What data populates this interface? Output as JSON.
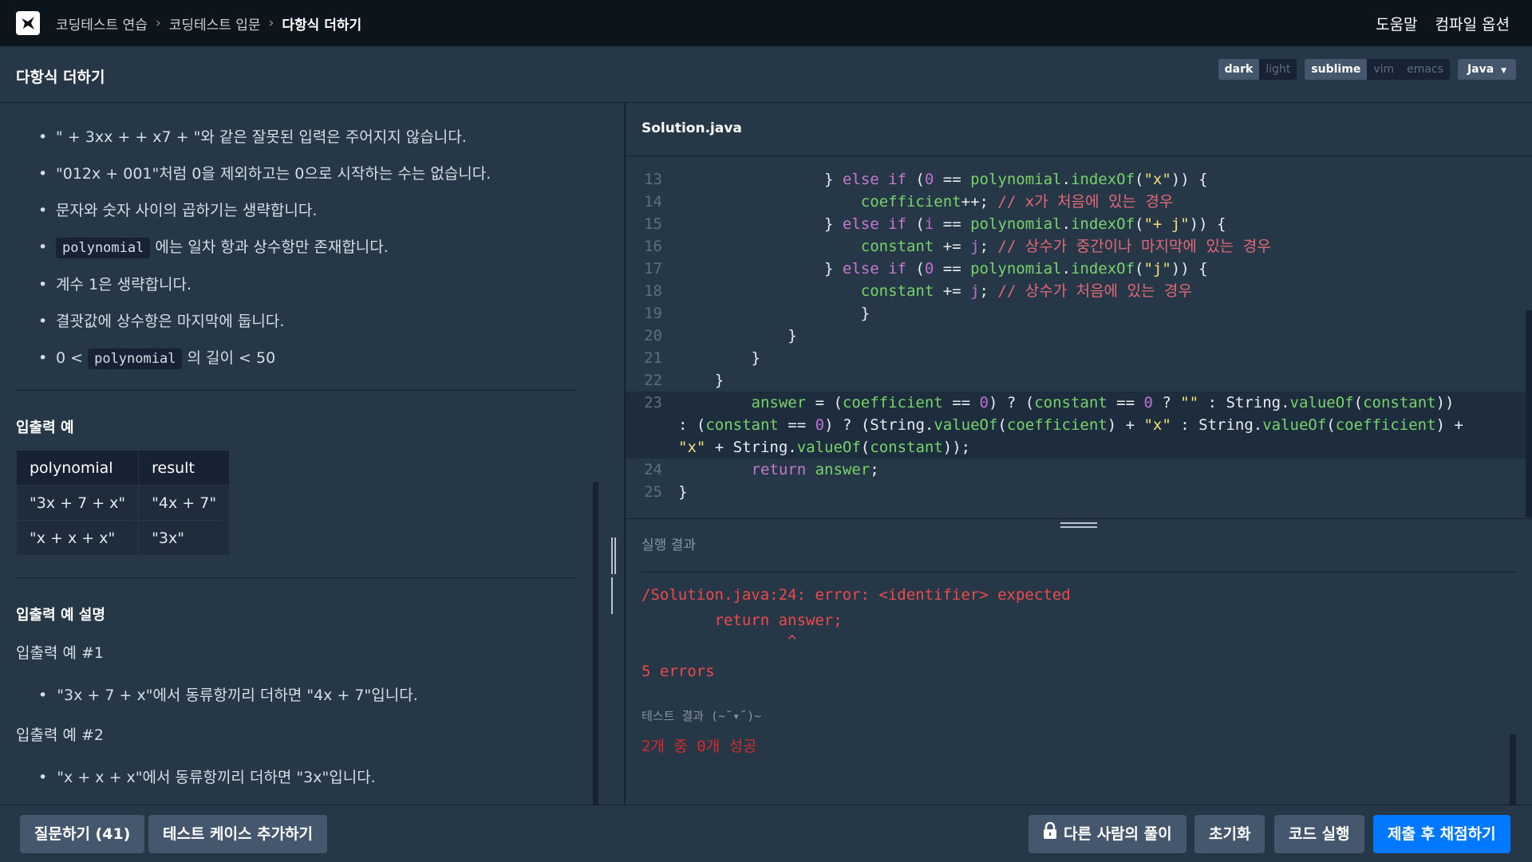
{
  "topbar": {
    "breadcrumbs": [
      "코딩테스트 연습",
      "코딩테스트 입문",
      "다항식 더하기"
    ],
    "menu_help": "도움말",
    "menu_compile": "컴파일 옵션"
  },
  "titlebar": {
    "title": "다항식 더하기",
    "theme_options": [
      "dark",
      "light"
    ],
    "keymap_options": [
      "sublime",
      "vim",
      "emacs"
    ],
    "language": "Java"
  },
  "problem": {
    "rules": [
      {
        "pre": "\" + 3xx + + x7 + \"와 같은 잘못된 입력은 주어지지 않습니다.",
        "code": "",
        "post": ""
      },
      {
        "pre": "\"012x + 001\"처럼 0을 제외하고는 0으로 시작하는 수는 없습니다.",
        "code": "",
        "post": ""
      },
      {
        "pre": "문자와 숫자 사이의 곱하기는 생략합니다.",
        "code": "",
        "post": ""
      },
      {
        "pre": "",
        "code": "polynomial",
        "post": "에는 일차 항과 상수항만 존재합니다."
      },
      {
        "pre": "계수 1은 생략합니다.",
        "code": "",
        "post": ""
      },
      {
        "pre": "결괏값에 상수항은 마지막에 둡니다.",
        "code": "",
        "post": ""
      },
      {
        "pre": "0 < ",
        "code": "polynomial",
        "post": "의 길이 < 50"
      }
    ],
    "io_heading": "입출력 예",
    "io_table": {
      "headers": [
        "polynomial",
        "result"
      ],
      "rows": [
        [
          "\"3x + 7 + x\"",
          "\"4x + 7\""
        ],
        [
          "\"x + x + x\"",
          "\"3x\""
        ]
      ]
    },
    "explain_heading": "입출력 예 설명",
    "example1_title": "입출력 예 #1",
    "example1_text": "\"3x + 7 + x\"에서 동류항끼리 더하면 \"4x + 7\"입니다.",
    "example2_title": "입출력 예 #2",
    "example2_text": "\"x + x + x\"에서 동류항끼리 더하면 \"3x\"입니다."
  },
  "editor": {
    "filename": "Solution.java",
    "line_numbers": [
      "13",
      "14",
      "15",
      "16",
      "17",
      "18",
      "19",
      "20",
      "21",
      "22",
      "23",
      "",
      "",
      "24",
      "25"
    ]
  },
  "result": {
    "heading": "실행 결과",
    "error_line1": "/Solution.java:24: error: <identifier> expected",
    "error_line2": "        return answer;",
    "error_caret": "                ^",
    "error_count": "5 errors",
    "test_heading": "테스트 결과 (~˘▾˘)~",
    "test_result": "2개 중 0개 성공"
  },
  "bottom": {
    "ask_label": "질문하기 (41)",
    "add_testcase_label": "테스트 케이스 추가하기",
    "others_solution_label": "다른 사람의 풀이",
    "reset_label": "초기화",
    "run_label": "코드 실행",
    "submit_label": "제출 후 채점하기"
  },
  "colors": {
    "background": "#263747",
    "topbar": "#0c151c",
    "primary": "#0078ff",
    "error": "#ef4a4a"
  }
}
